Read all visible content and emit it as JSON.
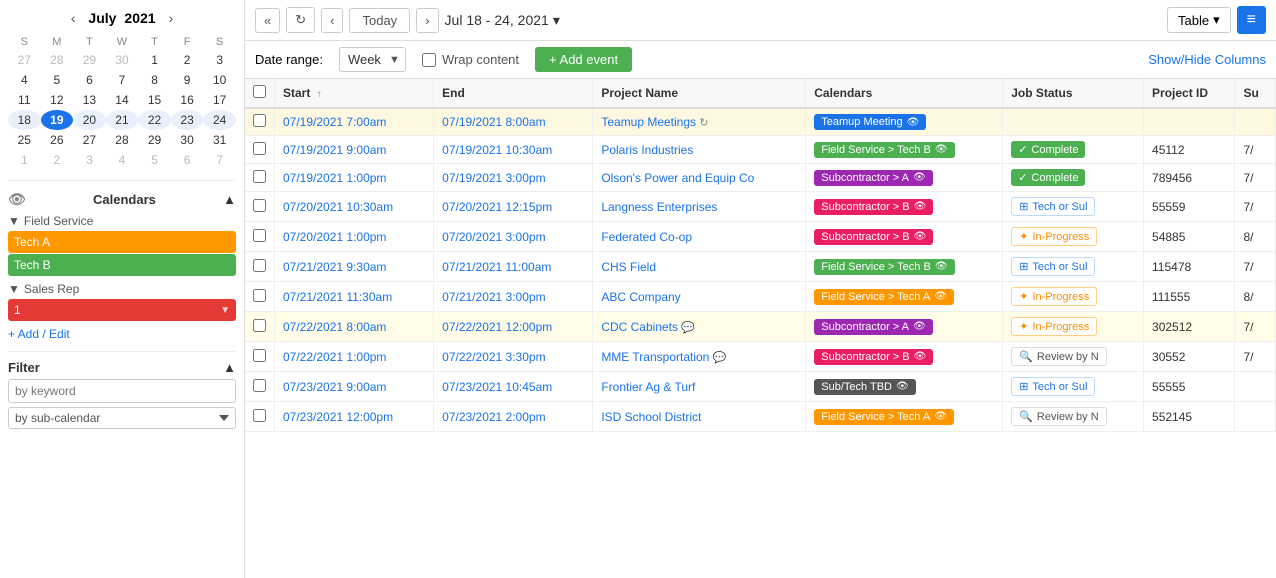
{
  "sidebar": {
    "mini_cal": {
      "month": "July",
      "year": "2021",
      "days_of_week": [
        "S",
        "M",
        "T",
        "W",
        "T",
        "F",
        "S"
      ],
      "weeks": [
        [
          {
            "d": "27",
            "other": true
          },
          {
            "d": "28",
            "other": true
          },
          {
            "d": "29",
            "other": true
          },
          {
            "d": "30",
            "other": true
          },
          {
            "d": "1"
          },
          {
            "d": "2"
          },
          {
            "d": "3"
          }
        ],
        [
          {
            "d": "4"
          },
          {
            "d": "5"
          },
          {
            "d": "6"
          },
          {
            "d": "7"
          },
          {
            "d": "8"
          },
          {
            "d": "9"
          },
          {
            "d": "10"
          }
        ],
        [
          {
            "d": "11"
          },
          {
            "d": "12"
          },
          {
            "d": "13"
          },
          {
            "d": "14"
          },
          {
            "d": "15"
          },
          {
            "d": "16"
          },
          {
            "d": "17"
          }
        ],
        [
          {
            "d": "18",
            "sel": true
          },
          {
            "d": "19",
            "sel": true,
            "today": true
          },
          {
            "d": "20",
            "sel": true
          },
          {
            "d": "21",
            "sel": true
          },
          {
            "d": "22",
            "sel": true
          },
          {
            "d": "23",
            "sel": true
          },
          {
            "d": "24",
            "sel": true
          }
        ],
        [
          {
            "d": "25"
          },
          {
            "d": "26"
          },
          {
            "d": "27"
          },
          {
            "d": "28"
          },
          {
            "d": "29"
          },
          {
            "d": "30"
          },
          {
            "d": "31"
          }
        ],
        [
          {
            "d": "1",
            "other": true
          },
          {
            "d": "2",
            "other": true
          },
          {
            "d": "3",
            "other": true
          },
          {
            "d": "4",
            "other": true
          },
          {
            "d": "5",
            "other": true
          },
          {
            "d": "6",
            "other": true
          },
          {
            "d": "7",
            "other": true
          }
        ]
      ]
    },
    "calendars_label": "Calendars",
    "field_service_label": "Field Service",
    "tech_a_label": "Tech A",
    "tech_b_label": "Tech B",
    "sales_rep_label": "Sales Rep",
    "sales_rep_item": "1",
    "add_edit_label": "+ Add / Edit",
    "filter_label": "Filter",
    "filter_keyword_placeholder": "by keyword",
    "filter_subcalendar_placeholder": "by sub-calendar"
  },
  "toolbar": {
    "prev_prev_label": "«",
    "refresh_label": "↻",
    "prev_label": "‹",
    "today_label": "Today",
    "next_label": "›",
    "date_range_label": "Jul 18 - 24, 2021",
    "date_range_arrow": "▾",
    "table_label": "Table",
    "table_arrow": "▾",
    "menu_icon": "≡"
  },
  "options_bar": {
    "date_range_label": "Date range:",
    "week_option": "Week",
    "wrap_content_label": "Wrap content",
    "add_event_label": "+ Add event",
    "show_hide_label": "Show/Hide Columns"
  },
  "table": {
    "columns": [
      "Start ↑",
      "End",
      "Project Name",
      "Calendars",
      "Job Status",
      "Project ID",
      "Su"
    ],
    "rows": [
      {
        "start": "07/19/2021 7:00am",
        "end": "07/19/2021 8:00am",
        "project": "Teamup Meetings",
        "project_icon": "↻",
        "calendar_label": "Teamup Meeting",
        "calendar_color": "#1a73e8",
        "calendar_icon": "👁",
        "job_status": "",
        "job_status_type": "",
        "project_id": "",
        "su": "",
        "row_class": "teamup"
      },
      {
        "start": "07/19/2021 9:00am",
        "end": "07/19/2021 10:30am",
        "project": "Polaris Industries",
        "project_icon": "",
        "calendar_label": "Field Service > Tech B",
        "calendar_color": "#4caf50",
        "calendar_icon": "👁",
        "job_status": "Complete",
        "job_status_type": "complete",
        "project_id": "45112",
        "su": "7/",
        "row_class": ""
      },
      {
        "start": "07/19/2021 1:00pm",
        "end": "07/19/2021 3:00pm",
        "project": "Olson's Power and Equip Co",
        "project_icon": "",
        "calendar_label": "Subcontractor > A",
        "calendar_color": "#9c27b0",
        "calendar_icon": "👁",
        "job_status": "Complete",
        "job_status_type": "complete",
        "project_id": "789456",
        "su": "7/",
        "row_class": ""
      },
      {
        "start": "07/20/2021 10:30am",
        "end": "07/20/2021 12:15pm",
        "project": "Langness Enterprises",
        "project_icon": "",
        "calendar_label": "Subcontractor > B",
        "calendar_color": "#e91e63",
        "calendar_icon": "👁",
        "job_status": "Tech or Sul",
        "job_status_type": "techsuk",
        "project_id": "55559",
        "su": "7/",
        "row_class": ""
      },
      {
        "start": "07/20/2021 1:00pm",
        "end": "07/20/2021 3:00pm",
        "project": "Federated Co-op",
        "project_icon": "",
        "calendar_label": "Subcontractor > B",
        "calendar_color": "#e91e63",
        "calendar_icon": "👁",
        "job_status": "In-Progress",
        "job_status_type": "inprogress",
        "project_id": "54885",
        "su": "8/",
        "row_class": ""
      },
      {
        "start": "07/21/2021 9:30am",
        "end": "07/21/2021 11:00am",
        "project": "CHS Field",
        "project_icon": "",
        "calendar_label": "Field Service > Tech B",
        "calendar_color": "#4caf50",
        "calendar_icon": "👁",
        "job_status": "Tech or Sul",
        "job_status_type": "techsuk",
        "project_id": "115478",
        "su": "7/",
        "row_class": ""
      },
      {
        "start": "07/21/2021 11:30am",
        "end": "07/21/2021 3:00pm",
        "project": "ABC Company",
        "project_icon": "",
        "calendar_label": "Field Service > Tech A",
        "calendar_color": "#ff9800",
        "calendar_icon": "👁",
        "job_status": "In-Progress",
        "job_status_type": "inprogress",
        "project_id": "111555",
        "su": "8/",
        "row_class": ""
      },
      {
        "start": "07/22/2021 8:00am",
        "end": "07/22/2021 12:00pm",
        "project": "CDC Cabinets",
        "project_icon": "💬",
        "calendar_label": "Subcontractor > A",
        "calendar_color": "#9c27b0",
        "calendar_icon": "👁",
        "job_status": "In-Progress",
        "job_status_type": "inprogress",
        "project_id": "302512",
        "su": "7/",
        "row_class": "highlighted"
      },
      {
        "start": "07/22/2021 1:00pm",
        "end": "07/22/2021 3:30pm",
        "project": "MME Transportation",
        "project_icon": "💬",
        "calendar_label": "Subcontractor > B",
        "calendar_color": "#e91e63",
        "calendar_icon": "👁",
        "job_status": "Review by N",
        "job_status_type": "reviewby",
        "project_id": "30552",
        "su": "7/",
        "row_class": ""
      },
      {
        "start": "07/23/2021 9:00am",
        "end": "07/23/2021 10:45am",
        "project": "Frontier Ag & Turf",
        "project_icon": "",
        "calendar_label": "Sub/Tech TBD",
        "calendar_color": "#333",
        "calendar_icon": "👁",
        "job_status": "Tech or Sul",
        "job_status_type": "techsuk",
        "project_id": "55555",
        "su": "",
        "row_class": ""
      },
      {
        "start": "07/23/2021 12:00pm",
        "end": "07/23/2021 2:00pm",
        "project": "ISD School District",
        "project_icon": "",
        "calendar_label": "Field Service > Tech A",
        "calendar_color": "#ff9800",
        "calendar_icon": "👁",
        "job_status": "Review by N",
        "job_status_type": "reviewby",
        "project_id": "552145",
        "su": "",
        "row_class": ""
      }
    ]
  },
  "colors": {
    "tech_a": "#ff9800",
    "tech_b": "#4caf50",
    "sales_rep_1": "#e53935",
    "field_service_group": "#555",
    "sales_rep_group": "#555"
  }
}
